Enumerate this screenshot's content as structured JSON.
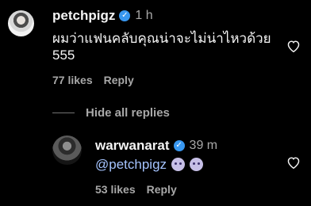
{
  "comment": {
    "username": "petchpigz",
    "time": "1 h",
    "text_line1": "ผมว่าแฟนคลับคุณน่าจะไม่น่าไหวด้วย",
    "text_line2": "555",
    "likes": "77 likes",
    "reply_label": "Reply"
  },
  "toggle": {
    "label": "Hide all replies"
  },
  "reply": {
    "username": "warwanarat",
    "time": "39 m",
    "mention": "@petchpigz",
    "likes": "53 likes",
    "reply_label": "Reply"
  },
  "icons": {
    "verified": "verified-badge-icon",
    "like": "heart-outline-icon",
    "emoji": "smiling-ghost-emoji-icon"
  },
  "colors": {
    "background": "#000000",
    "text": "#f5f5f5",
    "muted": "#a8a8a8",
    "verified": "#3897f0"
  }
}
